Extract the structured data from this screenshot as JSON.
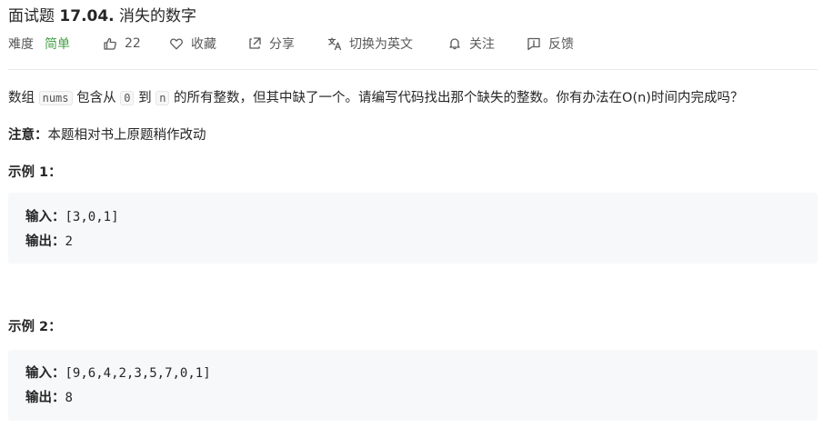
{
  "header": {
    "title_prefix": "面试题 ",
    "title_number": "17.04.",
    "title_name": " 消失的数字"
  },
  "meta": {
    "difficulty_label": "难度",
    "difficulty_value": "简单",
    "likes": "22",
    "favorite_label": "收藏",
    "share_label": "分享",
    "translate_label": "切换为英文",
    "follow_label": "关注",
    "feedback_label": "反馈",
    "colors": {
      "easy": "#43a047",
      "text": "#595959"
    }
  },
  "description": {
    "part1": "数组",
    "code1": "nums",
    "part2": "包含从",
    "code2": "0",
    "part3": "到",
    "code3": "n",
    "part4": "的所有整数，但其中缺了一个。请编写代码找出那个缺失的整数。你有办法在O(n)时间内完成吗？"
  },
  "note": {
    "label": "注意：",
    "text": "本题相对书上原题稍作改动"
  },
  "examples": [
    {
      "title": "示例 1：",
      "input_label": "输入：",
      "input_value": "[3,0,1]",
      "output_label": "输出：",
      "output_value": "2"
    },
    {
      "title": "示例 2：",
      "input_label": "输入：",
      "input_value": "[9,6,4,2,3,5,7,0,1]",
      "output_label": "输出：",
      "output_value": "8"
    }
  ]
}
